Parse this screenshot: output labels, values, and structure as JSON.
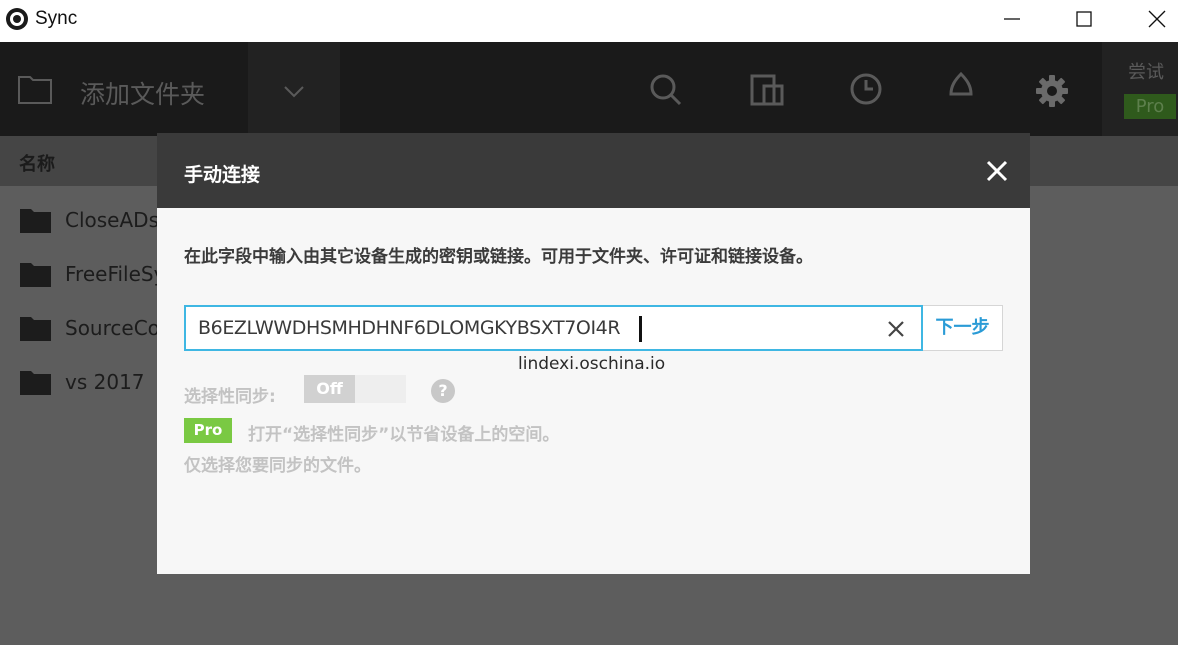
{
  "window": {
    "title": "Sync",
    "icon": "sync-eye-icon",
    "controls": [
      "minimize-icon",
      "maximize-icon",
      "close-icon"
    ]
  },
  "toolbar": {
    "add_folder_label": "添加文件夹",
    "icons": [
      "folder-outline-icon",
      "chevron-down-icon",
      "search-icon",
      "share-device-icon",
      "history-icon",
      "notification-icon",
      "gear-icon"
    ],
    "trial_label": "尝试",
    "pro_label": "Pro"
  },
  "list": {
    "column_name": "名称",
    "items": [
      {
        "name": "CloseADs"
      },
      {
        "name": "FreeFileSy"
      },
      {
        "name": "SourceCo"
      },
      {
        "name": "vs 2017"
      }
    ]
  },
  "modal": {
    "title": "手动连接",
    "description": "在此字段中输入由其它设备生成的密钥或链接。可用于文件夹、许可证和链接设备。",
    "key_value": "B6EZLWWDHSMHDHNF6DLOMGKYBSXT7OI4R",
    "next_label": "下一步",
    "watermark": "lindexi.oschina.io",
    "selective_sync_label": "选择性同步:",
    "toggle_state": "Off",
    "help_symbol": "?",
    "pro_badge": "Pro",
    "pro_text_line1": "打开“选择性同步”以节省设备上的空间。",
    "pro_text_line2": "仅选择您要同步的文件。"
  },
  "colors": {
    "input_border": "#3fb7e3",
    "next_text": "#2a9bd6",
    "pro_green": "#7ac943",
    "modal_header": "#3a3a3a"
  }
}
